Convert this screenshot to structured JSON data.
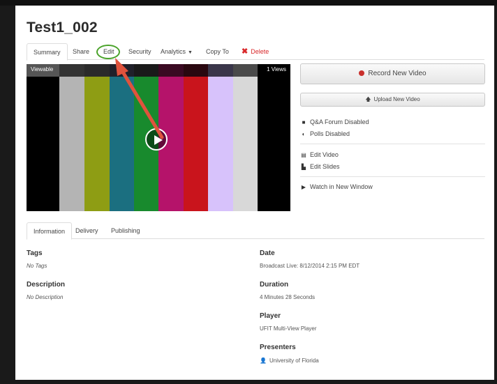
{
  "title": "Test1_002",
  "tabs": [
    {
      "label": "Summary"
    },
    {
      "label": "Share"
    },
    {
      "label": "Edit"
    },
    {
      "label": "Security"
    },
    {
      "label": "Analytics"
    },
    {
      "label": "Copy To"
    },
    {
      "label": "Delete"
    }
  ],
  "video": {
    "status_label": "Viewable",
    "views_label": "1 Views"
  },
  "actions": {
    "record_label": "Record New Video",
    "upload_label": "Upload New Video"
  },
  "side_items": {
    "qa_forum": "Q&A Forum Disabled",
    "polls": "Polls Disabled",
    "edit_video": "Edit Video",
    "edit_slides": "Edit Slides",
    "watch_window": "Watch in New Window"
  },
  "info_tabs": [
    {
      "label": "Information"
    },
    {
      "label": "Delivery"
    },
    {
      "label": "Publishing"
    }
  ],
  "info": {
    "tags_label": "Tags",
    "tags_value": "No Tags",
    "description_label": "Description",
    "description_value": "No Description",
    "date_label": "Date",
    "date_value": "Broadcast Live: 8/12/2014 2:15 PM EDT",
    "duration_label": "Duration",
    "duration_value": "4 Minutes 28 Seconds",
    "player_label": "Player",
    "player_value": "UFIT Multi-View Player",
    "presenters_label": "Presenters",
    "presenters_value": "University of Florida"
  },
  "colors": {
    "delete_red": "#d9292b",
    "annotation_green": "#4aa32a",
    "annotation_arrow": "#e0533d",
    "record_dot": "#c9302c"
  },
  "icons": {
    "qa_forum": "chat-bubble-icon",
    "polls": "pie-chart-icon",
    "edit_video": "film-icon",
    "edit_slides": "document-icon",
    "watch_window": "play-triangle-icon",
    "presenter": "person-icon"
  }
}
